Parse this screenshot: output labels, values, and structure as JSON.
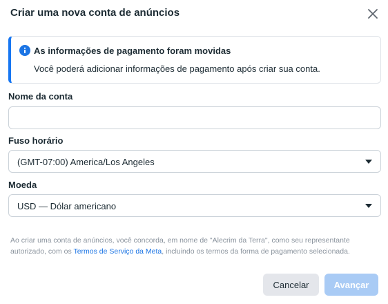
{
  "dialog": {
    "title": "Criar uma nova conta de anúncios"
  },
  "banner": {
    "icon": "info-icon",
    "title": "As informações de pagamento foram movidas",
    "text": "Você poderá adicionar informações de pagamento após criar sua conta."
  },
  "form": {
    "account_name": {
      "label": "Nome da conta",
      "value": "",
      "placeholder": ""
    },
    "timezone": {
      "label": "Fuso horário",
      "value": "(GMT-07:00) America/Los Angeles"
    },
    "currency": {
      "label": "Moeda",
      "value": "USD — Dólar americano"
    }
  },
  "terms": {
    "text_before": "Ao criar uma conta de anúncios, você concorda, em nome de \"Alecrim da Terra\", como seu representante autorizado, com os ",
    "link": "Termos de Serviço da Meta",
    "text_after": ", incluindo os termos da forma de pagamento selecionada."
  },
  "actions": {
    "cancel_label": "Cancelar",
    "next_label": "Avançar"
  },
  "colors": {
    "accent": "#1877f2",
    "link": "#1b74e4",
    "disabled_primary": "#a9cbf5",
    "secondary_button": "#e4e6eb"
  }
}
